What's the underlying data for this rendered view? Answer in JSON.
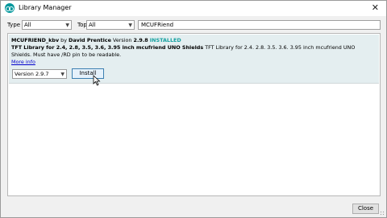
{
  "window": {
    "title": "Library Manager",
    "close_glyph": "✕",
    "icon": "arduino-icon"
  },
  "filters": {
    "type_label": "Type",
    "type_value": "All",
    "topic_label": "Topic",
    "topic_value": "All",
    "search_value": "MCUFRiend"
  },
  "library": {
    "name": "MCUFRIEND_kbv",
    "by": "by",
    "author": "David Prentice",
    "version_prefix": "Version",
    "version": "2.9.8",
    "installed_badge": "INSTALLED",
    "summary_bold": "TFT Library for 2.4, 2.8, 3.5, 3.6, 3.95 inch mcufriend UNO Shields",
    "summary_rest": "TFT Library for 2.4. 2.8. 3.5. 3.6. 3.95 inch mcufriend UNO",
    "summary_line2": "Shields. Must have /RD pin to be readable.",
    "more_info": "More info",
    "version_select": "Version 2.9.7",
    "install_label": "Install"
  },
  "footer": {
    "close_label": "Close"
  },
  "colors": {
    "installed": "#14a0a0",
    "selected_row": "#e4eef0",
    "arduino_teal": "#00979c"
  }
}
